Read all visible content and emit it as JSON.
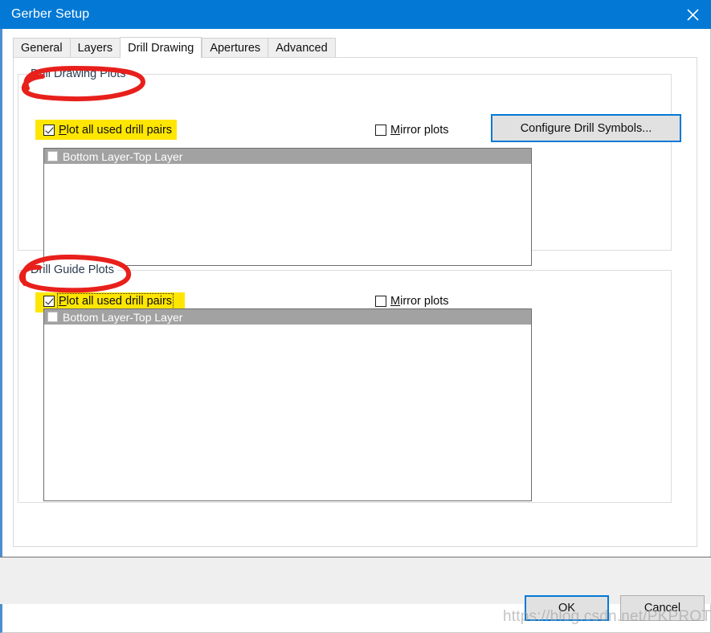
{
  "window": {
    "title": "Gerber Setup",
    "close_icon": "close-icon"
  },
  "tabs": [
    {
      "label": "General",
      "active": false
    },
    {
      "label": "Layers",
      "active": false
    },
    {
      "label": "Drill Drawing",
      "active": true
    },
    {
      "label": "Apertures",
      "active": false
    },
    {
      "label": "Advanced",
      "active": false
    }
  ],
  "drill_drawing_plots": {
    "group_label": "Drill Drawing Plots",
    "plot_all_checkbox": {
      "label_accel": "P",
      "label_rest": "lot all used drill pairs",
      "checked": true,
      "highlighted": true
    },
    "mirror_checkbox": {
      "label_accel": "M",
      "label_rest": "irror plots",
      "checked": false
    },
    "configure_button": "Configure Drill Symbols...",
    "list_items": [
      {
        "label": "Bottom Layer-Top Layer",
        "checked": false,
        "selected": true
      }
    ]
  },
  "drill_guide_plots": {
    "group_label": "Drill Guide Plots",
    "plot_all_checkbox": {
      "label_accel": "P",
      "label_rest": "lot all used drill pairs",
      "checked": true,
      "highlighted": true,
      "focused": true
    },
    "mirror_checkbox": {
      "label_accel": "M",
      "label_rest": "irror plots",
      "checked": false
    },
    "list_items": [
      {
        "label": "Bottom Layer-Top Layer",
        "checked": false,
        "selected": true
      }
    ]
  },
  "footer": {
    "ok_label": "OK",
    "cancel_label": "Cancel"
  },
  "watermark": {
    "text": "https://blog.csdn.net/PKPROTEUS"
  },
  "colors": {
    "titlebar": "#0379d5",
    "accent": "#0379d5",
    "annotation": "#e8201c",
    "highlight": "#ffe600",
    "list_selected": "#a2a2a2",
    "button_face": "#e1e1e1",
    "footer": "#efefef"
  }
}
